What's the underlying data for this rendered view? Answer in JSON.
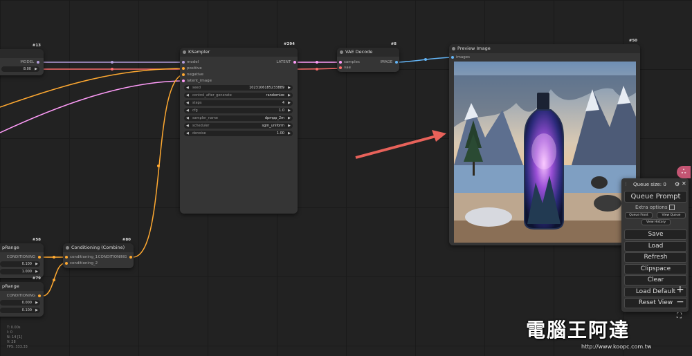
{
  "nodes": {
    "left_top": {
      "id": "#13",
      "output_label": "MODEL",
      "value": "8.00"
    },
    "ksampler": {
      "id": "#294",
      "title": "KSampler",
      "inputs": [
        "model",
        "positive",
        "negative",
        "latent_image"
      ],
      "output_label": "LATENT",
      "widgets": [
        {
          "label": "seed",
          "value": "1023106185233889"
        },
        {
          "label": "control_after_generate",
          "value": "randomize"
        },
        {
          "label": "steps",
          "value": "4"
        },
        {
          "label": "cfg",
          "value": "1.0"
        },
        {
          "label": "sampler_name",
          "value": "dpmpp_2m"
        },
        {
          "label": "scheduler",
          "value": "sgm_uniform"
        },
        {
          "label": "denoise",
          "value": "1.00"
        }
      ]
    },
    "vae_decode": {
      "id": "#8",
      "title": "VAE Decode",
      "inputs": [
        "samples",
        "vae"
      ],
      "output_label": "IMAGE"
    },
    "preview": {
      "id": "#50",
      "title": "Preview Image",
      "input_label": "images"
    },
    "cond_range_1": {
      "id": "#58",
      "title": "pRange",
      "output_label": "CONDITIONING",
      "v1": "0.100",
      "v2": "1.000"
    },
    "cond_range_2": {
      "id": "#79",
      "title": "pRange",
      "output_label": "CONDITIONING",
      "v1": "0.000",
      "v2": "0.100"
    },
    "cond_combine": {
      "id": "#80",
      "title": "Conditioning (Combine)",
      "inputs": [
        "conditioning_1",
        "conditioning_2"
      ],
      "output_label": "CONDITIONING"
    }
  },
  "menu": {
    "queue_size_label": "Queue size: 0",
    "queue_prompt": "Queue Prompt",
    "extra_options": "Extra options",
    "queue_front": "Queue Front",
    "view_queue": "View Queue",
    "view_history": "View History",
    "buttons": [
      "Save",
      "Load",
      "Refresh",
      "Clipspace",
      "Clear",
      "Load Default",
      "Reset View"
    ]
  },
  "stats": [
    "T: 0.00s",
    "I: 0",
    "N: 14 [1]",
    "V: 28",
    "FPS: 333.33"
  ],
  "watermark": {
    "text": "電腦王阿達",
    "url": "http://www.koopc.com.tw"
  },
  "colors": {
    "model_wire": "#b39ddb",
    "cond_wire": "#ffa931",
    "latent_wire": "#ff9cf9",
    "vae_wire": "#ff6e6e",
    "image_wire": "#64b5f6",
    "arrow": "#e8625a"
  }
}
